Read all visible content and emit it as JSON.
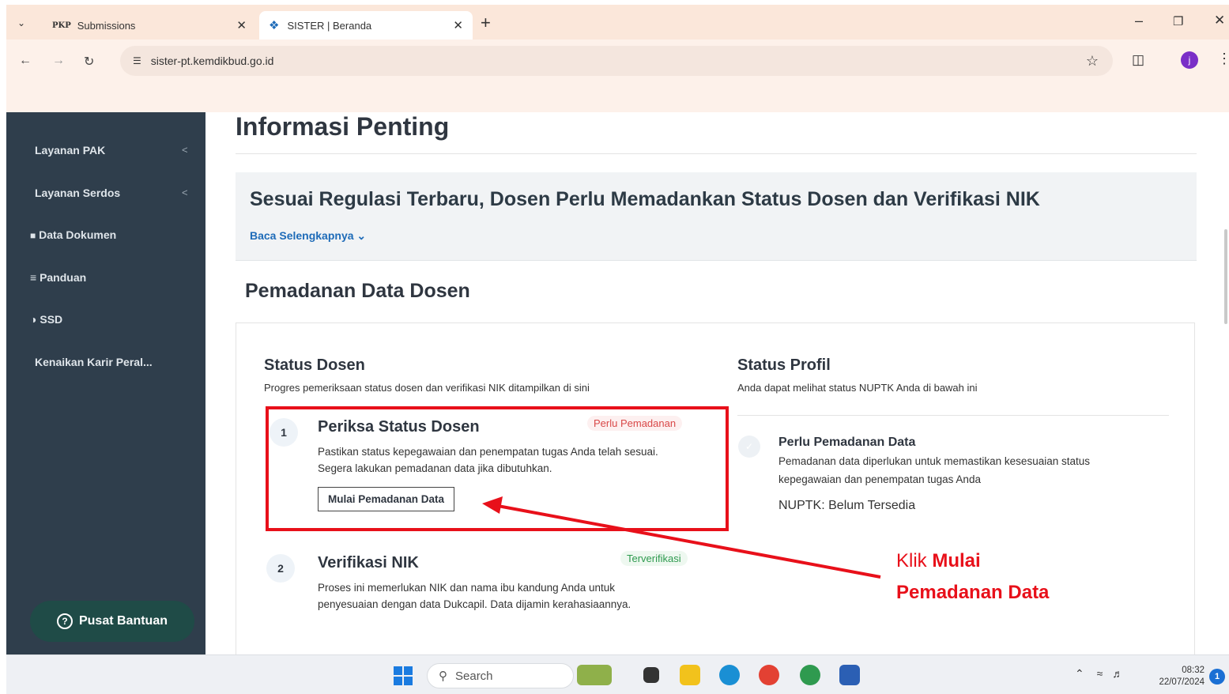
{
  "browser": {
    "tabs": [
      {
        "favicon": "PKP",
        "title": "Submissions"
      },
      {
        "favicon": "sister-logo-icon",
        "title": "SISTER | Beranda"
      }
    ],
    "new_tab": "+",
    "url": "sister-pt.kemdikbud.go.id",
    "profile_initial": "j"
  },
  "sidebar": {
    "items": [
      {
        "label": "Layanan PAK",
        "chevron": "<"
      },
      {
        "label": "Layanan Serdos",
        "chevron": "<"
      },
      {
        "label": "Data Dokumen",
        "icon": "folder-icon"
      },
      {
        "label": "Panduan",
        "icon": "list-icon"
      },
      {
        "label": "SSD",
        "icon": "half-circle-icon"
      },
      {
        "label": "Kenaikan Karir Peral..."
      }
    ],
    "help_label": "Pusat Bantuan"
  },
  "main": {
    "title": "Informasi Penting",
    "banner": {
      "heading": "Sesuai Regulasi Terbaru, Dosen Perlu Memadankan Status Dosen dan Verifikasi NIK",
      "link": "Baca Selengkapnya"
    },
    "section_title": "Pemadanan Data Dosen",
    "status_dosen": {
      "title": "Status Dosen",
      "subtitle": "Progres pemeriksaan status dosen dan verifikasi NIK ditampilkan di sini",
      "steps": [
        {
          "number": "1",
          "title": "Periksa Status Dosen",
          "badge": "Perlu Pemadanan",
          "desc": "Pastikan status kepegawaian dan penempatan tugas Anda telah sesuai. Segera lakukan pemadanan data jika dibutuhkan.",
          "button": "Mulai Pemadanan Data"
        },
        {
          "number": "2",
          "title": "Verifikasi NIK",
          "badge": "Terverifikasi",
          "desc": "Proses ini memerlukan NIK dan nama ibu kandung Anda untuk penyesuaian dengan data Dukcapil. Data dijamin kerahasiaannya."
        }
      ]
    },
    "status_profil": {
      "title": "Status Profil",
      "subtitle": "Anda dapat melihat status NUPTK Anda di bawah ini",
      "item_title": "Perlu Pemadanan Data",
      "item_desc": "Pemadanan data diperlukan untuk memastikan kesesuaian status kepegawaian dan penempatan tugas Anda",
      "nuptk": "NUPTK: Belum Tersedia"
    }
  },
  "annotation": {
    "prefix": "Klik",
    "bold1": "Mulai",
    "bold2": "Pemadanan Data"
  },
  "taskbar": {
    "search": "Search",
    "time": "08:32",
    "date": "22/07/2024",
    "notifications": "1"
  },
  "colors": {
    "annotation_red": "#e8101a",
    "sidebar": "#2f3e4c",
    "link_blue": "#1e6bb8"
  }
}
